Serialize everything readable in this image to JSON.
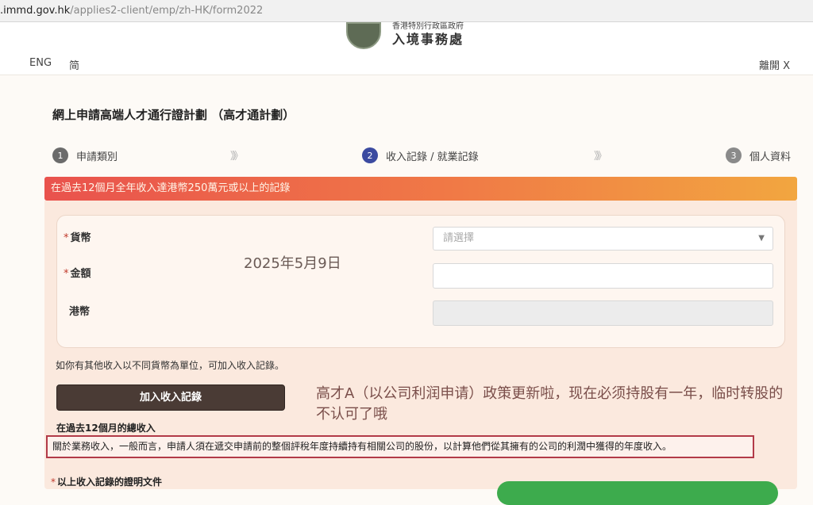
{
  "browser": {
    "url_host": ".immd.gov.hk",
    "url_path": "/applies2-client/emp/zh-HK/form2022"
  },
  "header": {
    "agency_name_top": "香港特別行政區政府",
    "agency_name": "入境事務處",
    "lang_english": "ENG",
    "lang_simplified": "简",
    "exit_label": "離開 X"
  },
  "page": {
    "title": "網上申請高端人才通行證計劃 （高才通計劃）"
  },
  "steps": [
    {
      "number": "1",
      "label": "申請類別"
    },
    {
      "number": "2",
      "label": "收入記錄 / 就業記錄"
    },
    {
      "number": "3",
      "label": "個人資料"
    }
  ],
  "step_separator": "》》",
  "section": {
    "banner": "在過去12個月全年收入達港幣250萬元或以上的記錄"
  },
  "form": {
    "currency_label": "貨幣",
    "currency_placeholder": "請選擇",
    "amount_label": "金額",
    "hkd_label": "港幣",
    "required_mark": "*"
  },
  "overlay": {
    "date": "2025年5月9日",
    "note": "高才A（以公司利润申请）政策更新啦，现在必须持股有一年，临时转股的不认可了哦"
  },
  "income": {
    "hint": "如你有其他收入以不同貨幣為單位，可加入收入記錄。",
    "add_button": "加入收入記錄",
    "total_label": "在過去12個月的總收入",
    "notice": "關於業務收入，一般而言，申請人須在遞交申請前的整個評稅年度持續持有相關公司的股份，以計算他們從其擁有的公司的利潤中獲得的年度收入。",
    "proof_label": "以上收入記錄的證明文件"
  },
  "colors": {
    "banner_start": "#e9524d",
    "banner_end": "#f2a640",
    "step_current": "#3b4aa0",
    "add_button_bg": "#4a3b35",
    "notice_border": "#b23a48",
    "upload_button": "#3dab4d"
  }
}
